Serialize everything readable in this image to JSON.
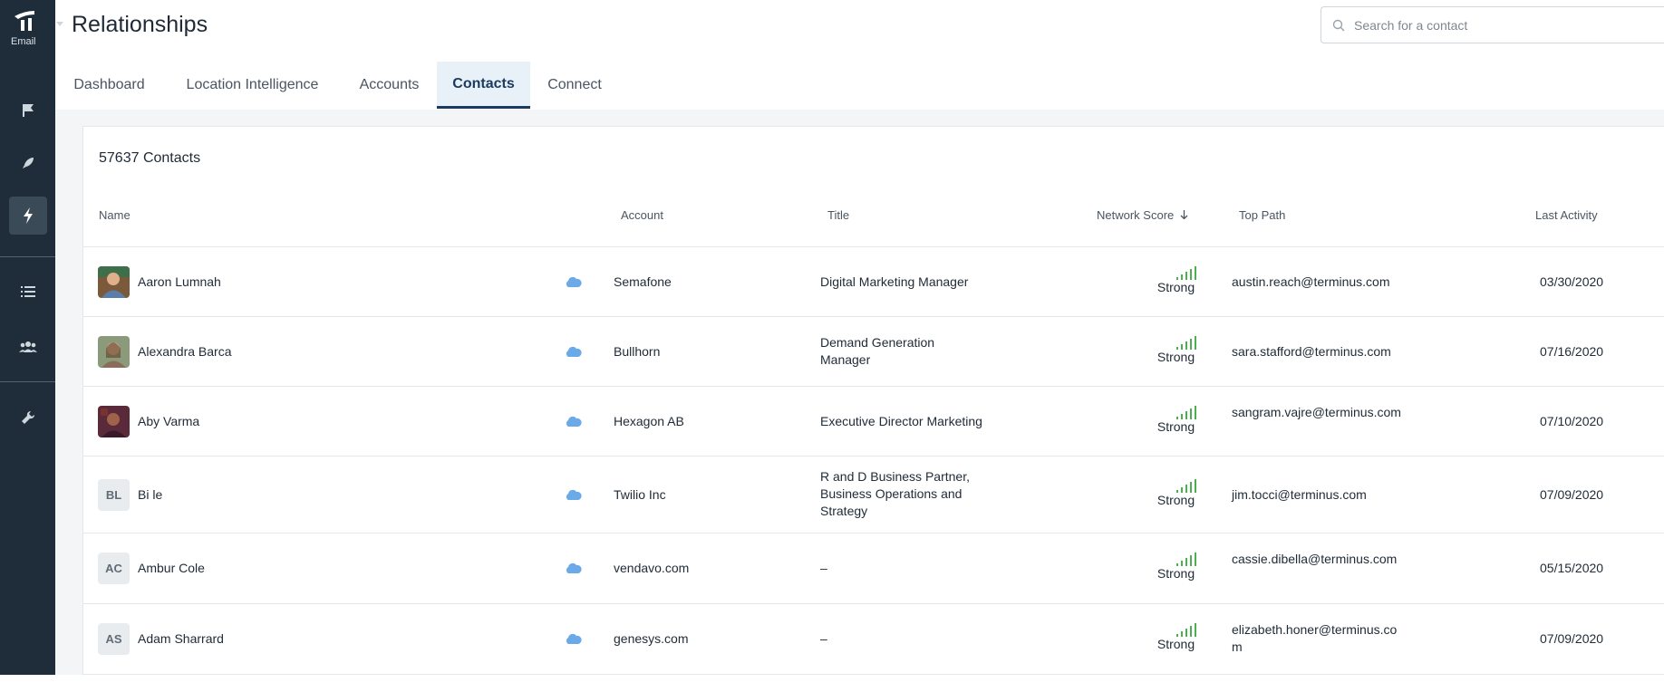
{
  "app": {
    "logo_label": "Email",
    "title": "Relationships"
  },
  "search": {
    "placeholder": "Search for a contact"
  },
  "tabs": [
    {
      "label": "Dashboard"
    },
    {
      "label": "Location Intelligence"
    },
    {
      "label": "Accounts"
    },
    {
      "label": "Contacts",
      "active": true
    },
    {
      "label": "Connect"
    }
  ],
  "contacts": {
    "count_label": "57637 Contacts"
  },
  "columns": {
    "name": "Name",
    "account": "Account",
    "title": "Title",
    "network_score": "Network Score",
    "top_path": "Top Path",
    "last_activity": "Last Activity"
  },
  "rows": [
    {
      "name": "Aaron Lumnah",
      "avatar": "photo",
      "account": "Semafone",
      "title": "Digital Marketing Manager",
      "score": "Strong",
      "top_path": "austin.reach@terminus.com",
      "last_activity": "03/30/2020"
    },
    {
      "name": "Alexandra Barca",
      "avatar": "photo",
      "account": "Bullhorn",
      "title": "Demand Generation Manager",
      "score": "Strong",
      "top_path": "sara.stafford@terminus.com",
      "last_activity": "07/16/2020"
    },
    {
      "name": "Aby Varma",
      "avatar": "photo",
      "account": "Hexagon AB",
      "title": "Executive Director Marketing",
      "score": "Strong",
      "top_path": "sangram.vajre@terminus.com",
      "last_activity": "07/10/2020"
    },
    {
      "name": "Bi le",
      "initials": "BL",
      "account": "Twilio Inc",
      "title": "R and D Business Partner, Business Operations and Strategy",
      "score": "Strong",
      "top_path": "jim.tocci@terminus.com",
      "last_activity": "07/09/2020"
    },
    {
      "name": "Ambur Cole",
      "initials": "AC",
      "account": "vendavo.com",
      "title": "–",
      "score": "Strong",
      "top_path": "cassie.dibella@terminus.com",
      "last_activity": "05/15/2020"
    },
    {
      "name": "Adam Sharrard",
      "initials": "AS",
      "account": "genesys.com",
      "title": "–",
      "score": "Strong",
      "top_path": "elizabeth.honer@terminus.com",
      "last_activity": "07/09/2020"
    }
  ],
  "colors": {
    "sidebar": "#1e2d39",
    "accent": "#1a3a5f",
    "score_green": "#4caf50",
    "cloud_blue": "#6aaae8"
  },
  "icons": [
    "logo-icon",
    "flag-icon",
    "rocket-icon",
    "bolt-icon",
    "list-icon",
    "people-icon",
    "wrench-icon",
    "search-icon",
    "cloud-icon",
    "signal-icon",
    "sort-down-icon"
  ]
}
